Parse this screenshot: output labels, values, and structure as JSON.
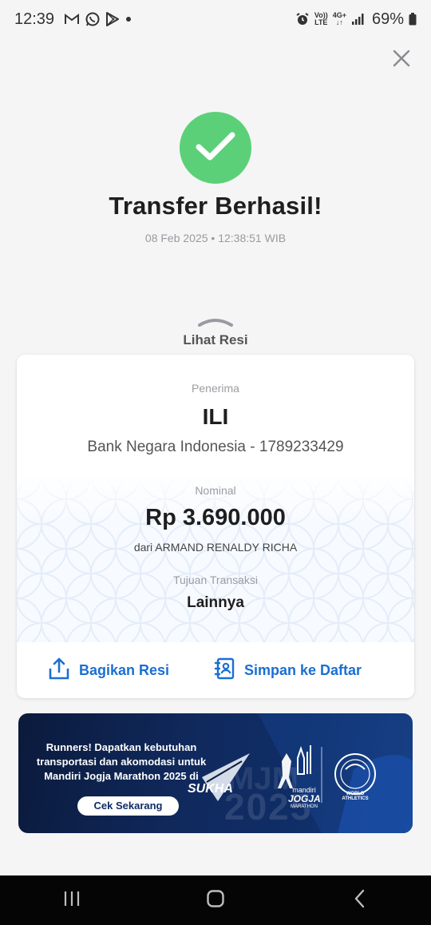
{
  "status_bar": {
    "time": "12:39",
    "left_icons": [
      "gmail-icon",
      "whatsapp-icon",
      "play-store-icon",
      "dot-icon"
    ],
    "right_icons": [
      "alarm-icon",
      "volte-icon",
      "4g-icon",
      "signal-icon",
      "battery-icon"
    ],
    "volte_top": "Vo))",
    "volte_bottom": "LTE",
    "net_label": "4G+",
    "battery": "69%"
  },
  "header": {
    "close_icon": "close-icon"
  },
  "result": {
    "title": "Transfer Berhasil!",
    "datetime": "08 Feb 2025 • 12:38:51 WIB",
    "success_color": "#5cd079"
  },
  "receipt_toggle": {
    "label": "Lihat Resi"
  },
  "receipt": {
    "recipient_label": "Penerima",
    "recipient_name": "ILI",
    "recipient_bank": "Bank Negara Indonesia - 1789233429",
    "amount_label": "Nominal",
    "amount": "Rp 3.690.000",
    "from": "dari ARMAND RENALDY RICHA",
    "purpose_label": "Tujuan Transaksi",
    "purpose": "Lainnya",
    "share_label": "Bagikan Resi",
    "save_label": "Simpan ke Daftar",
    "accent_color": "#1a6fd1"
  },
  "banner": {
    "text_line1": "Runners! Dapatkan kebutuhan",
    "text_line2": "transportasi dan akomodasi untuk",
    "text_line3": "Mandiri Jogja Marathon 2025 di",
    "cta": "Cek Sekarang",
    "brand_sukha": "SUKHA",
    "logo_mandiri": "mandiri",
    "logo_jogja": "JOGJA",
    "logo_marathon": "MARATHON",
    "bg_mjm": "MJM",
    "bg_year": "2025",
    "world_athletics": "WORLD ATHLETICS"
  },
  "nav_bar": {
    "icons": [
      "recent-apps-icon",
      "home-icon",
      "back-icon"
    ]
  }
}
